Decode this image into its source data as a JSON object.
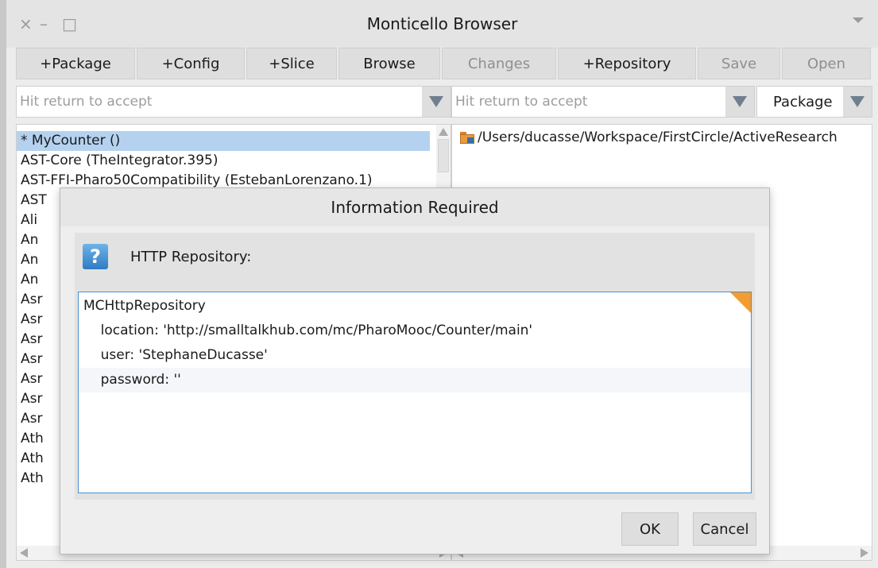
{
  "window": {
    "title": "Monticello Browser",
    "controls": {
      "close": "×",
      "minimize": "–",
      "maximize": "□"
    }
  },
  "toolbar": {
    "buttons": [
      {
        "label": "+Package",
        "enabled": true
      },
      {
        "label": "+Config",
        "enabled": true
      },
      {
        "label": "+Slice",
        "enabled": true
      },
      {
        "label": "Browse",
        "enabled": true
      },
      {
        "label": "Changes",
        "enabled": false
      },
      {
        "label": "+Repository",
        "enabled": true
      },
      {
        "label": "Save",
        "enabled": false
      },
      {
        "label": "Open",
        "enabled": false
      }
    ]
  },
  "left_filter": {
    "placeholder": "Hit return to accept"
  },
  "right_filter": {
    "placeholder": "Hit return to accept"
  },
  "right_select": {
    "value": "Package"
  },
  "packages": [
    "* MyCounter ()",
    "AST-Core (TheIntegrator.395)",
    "AST-FFI-Pharo50Compatibility (EstebanLorenzano.1)",
    "AST",
    "Ali",
    "An",
    "An",
    "An",
    "Asr",
    "Asr",
    "Asr",
    "Asr",
    "Asr",
    "Asr",
    "Asr",
    "Ath",
    "Ath",
    "Ath"
  ],
  "selected_package_index": 0,
  "repositories": [
    "/Users/ducasse/Workspace/FirstCircle/ActiveResearch"
  ],
  "dialog": {
    "title": "Information Required",
    "prompt": "HTTP Repository:",
    "code": [
      "MCHttpRepository",
      "    location: 'http://smalltalkhub.com/mc/PharoMooc/Counter/main'",
      "    user: 'StephaneDucasse'",
      "    password: ''"
    ],
    "ok_label": "OK",
    "cancel_label": "Cancel"
  },
  "colors": {
    "selection": "#b4d2ef",
    "focus_border": "#4a8fd0",
    "corner_accent": "#f39c2f"
  }
}
